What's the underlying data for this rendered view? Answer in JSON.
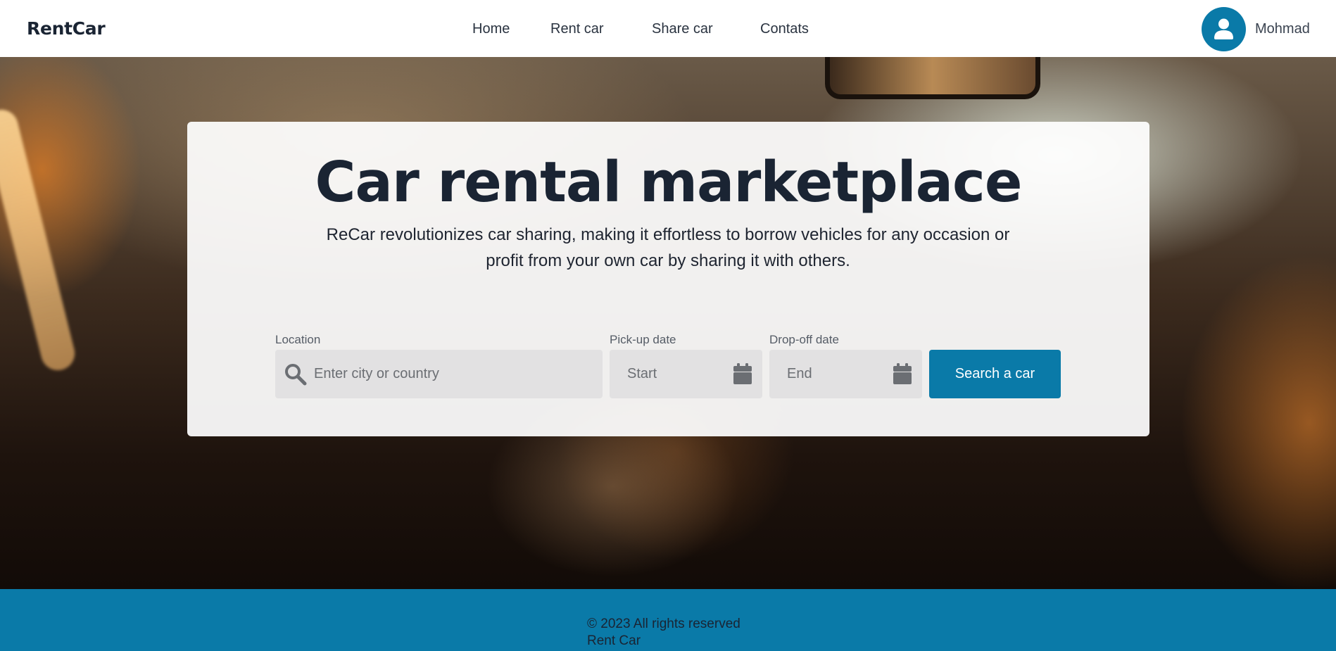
{
  "header": {
    "brand": "RentCar",
    "nav": [
      "Home",
      "Rent car",
      "Share car",
      "Contats"
    ],
    "user": {
      "name": "Mohmad",
      "avatar_icon": "user-icon"
    }
  },
  "hero": {
    "title": "Car rental marketplace",
    "subtitle": "ReCar revolutionizes car sharing, making it effortless to borrow vehicles for any occasion or profit from your own car by sharing it with others.",
    "search": {
      "location_label": "Location",
      "location_placeholder": "Enter city or country",
      "location_icon": "search-icon",
      "pickup_label": "Pick-up date",
      "pickup_placeholder": "Start",
      "dropoff_label": "Drop-off date",
      "dropoff_placeholder": "End",
      "date_icon": "calendar-icon",
      "button_label": "Search a car"
    }
  },
  "footer": {
    "copyright": "© 2023 All rights reserved",
    "brand": "Rent Car"
  },
  "colors": {
    "accent": "#0a7aa8",
    "text_dark": "#1a2433",
    "input_bg": "#e2e1e2"
  }
}
